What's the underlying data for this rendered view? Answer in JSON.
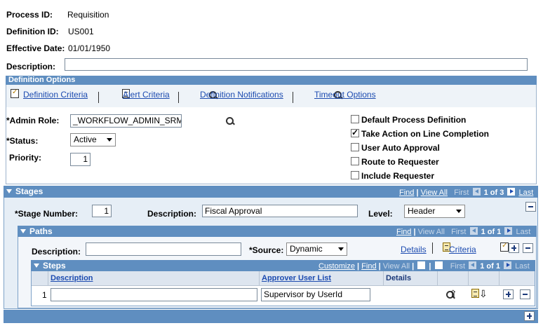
{
  "header": {
    "process_id_label": "Process ID:",
    "process_id_value": "Requisition",
    "definition_id_label": "Definition ID:",
    "definition_id_value": "US001",
    "effective_date_label": "Effective Date:",
    "effective_date_value": "01/01/1950",
    "description_label": "Description:",
    "description_value": ""
  },
  "definition_options": {
    "title": "Definition Options",
    "links": [
      "Definition Criteria",
      "Alert Criteria",
      "Definition Notifications",
      "Timeout Options"
    ],
    "admin_role_label": "*Admin Role:",
    "admin_role_value": "_WORKFLOW_ADMIN_SRM",
    "status_label": "*Status:",
    "status_value": "Active",
    "priority_label": "Priority:",
    "priority_value": "1",
    "checkboxes": [
      {
        "label": "Default Process Definition",
        "checked": false
      },
      {
        "label": "Take Action on Line Completion",
        "checked": true
      },
      {
        "label": "User Auto Approval",
        "checked": false
      },
      {
        "label": "Route to Requester",
        "checked": false
      },
      {
        "label": "Include Requester",
        "checked": false
      }
    ]
  },
  "stages": {
    "title": "Stages",
    "nav": {
      "find": "Find",
      "view_all": "View All",
      "first": "First",
      "count": "1 of 3",
      "last": "Last"
    },
    "stage_number_label": "*Stage Number:",
    "stage_number_value": "1",
    "description_label": "Description:",
    "description_value": "Fiscal Approval",
    "level_label": "Level:",
    "level_value": "Header"
  },
  "paths": {
    "title": "Paths",
    "nav": {
      "find": "Find",
      "view_all": "View All",
      "first": "First",
      "count": "1 of 1",
      "last": "Last"
    },
    "description_label": "Description:",
    "description_value": "",
    "source_label": "*Source:",
    "source_value": "Dynamic",
    "details_link": "Details",
    "criteria_link": "Criteria"
  },
  "steps": {
    "title": "Steps",
    "nav": {
      "customize": "Customize",
      "find": "Find",
      "view_all": "View All",
      "first": "First",
      "count": "1 of 1",
      "last": "Last"
    },
    "columns": [
      "Description",
      "Approver User List",
      "Details"
    ],
    "rows": [
      {
        "num": "1",
        "description": "",
        "approver_user_list": "Supervisor by UserId"
      }
    ]
  },
  "colors": {
    "bar": "#5f8ec0",
    "link": "#1c4bb0"
  }
}
